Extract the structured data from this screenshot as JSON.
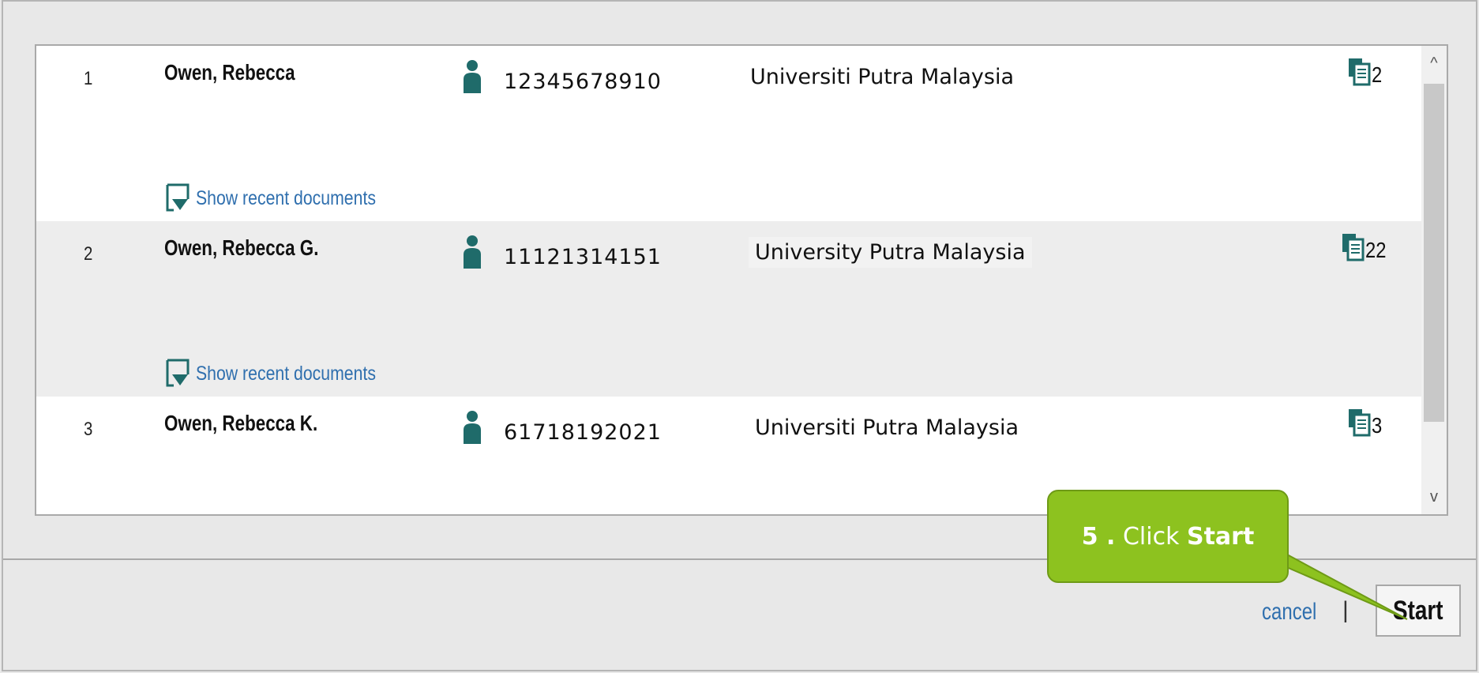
{
  "authors": [
    {
      "index": "1",
      "name": "Owen, Rebecca",
      "author_id": "12345678910",
      "affiliation": "Universiti Putra Malaysia",
      "documents": "2",
      "show_recent_label": "Show recent documents"
    },
    {
      "index": "2",
      "name": "Owen, Rebecca G.",
      "author_id": "11121314151",
      "affiliation": "University Putra Malaysia",
      "documents": "22",
      "show_recent_label": "Show recent documents"
    },
    {
      "index": "3",
      "name": "Owen, Rebecca K.",
      "author_id": "61718192021",
      "affiliation": "Universiti Putra Malaysia",
      "documents": "3"
    }
  ],
  "footer": {
    "cancel_label": "cancel",
    "separator": "|",
    "start_label": "Start"
  },
  "callout": {
    "step": "5 .",
    "action": "Click",
    "target": "Start"
  },
  "scrollbar": {
    "up_glyph": "^",
    "down_glyph": "v"
  },
  "colors": {
    "link": "#2f6fae",
    "icon_teal": "#1f6b6a",
    "callout_green": "#8dc21f",
    "row_alt_bg": "#ededed"
  },
  "icons": {
    "person": "person-icon",
    "documents": "documents-icon",
    "show_recent": "show-recent-icon"
  }
}
